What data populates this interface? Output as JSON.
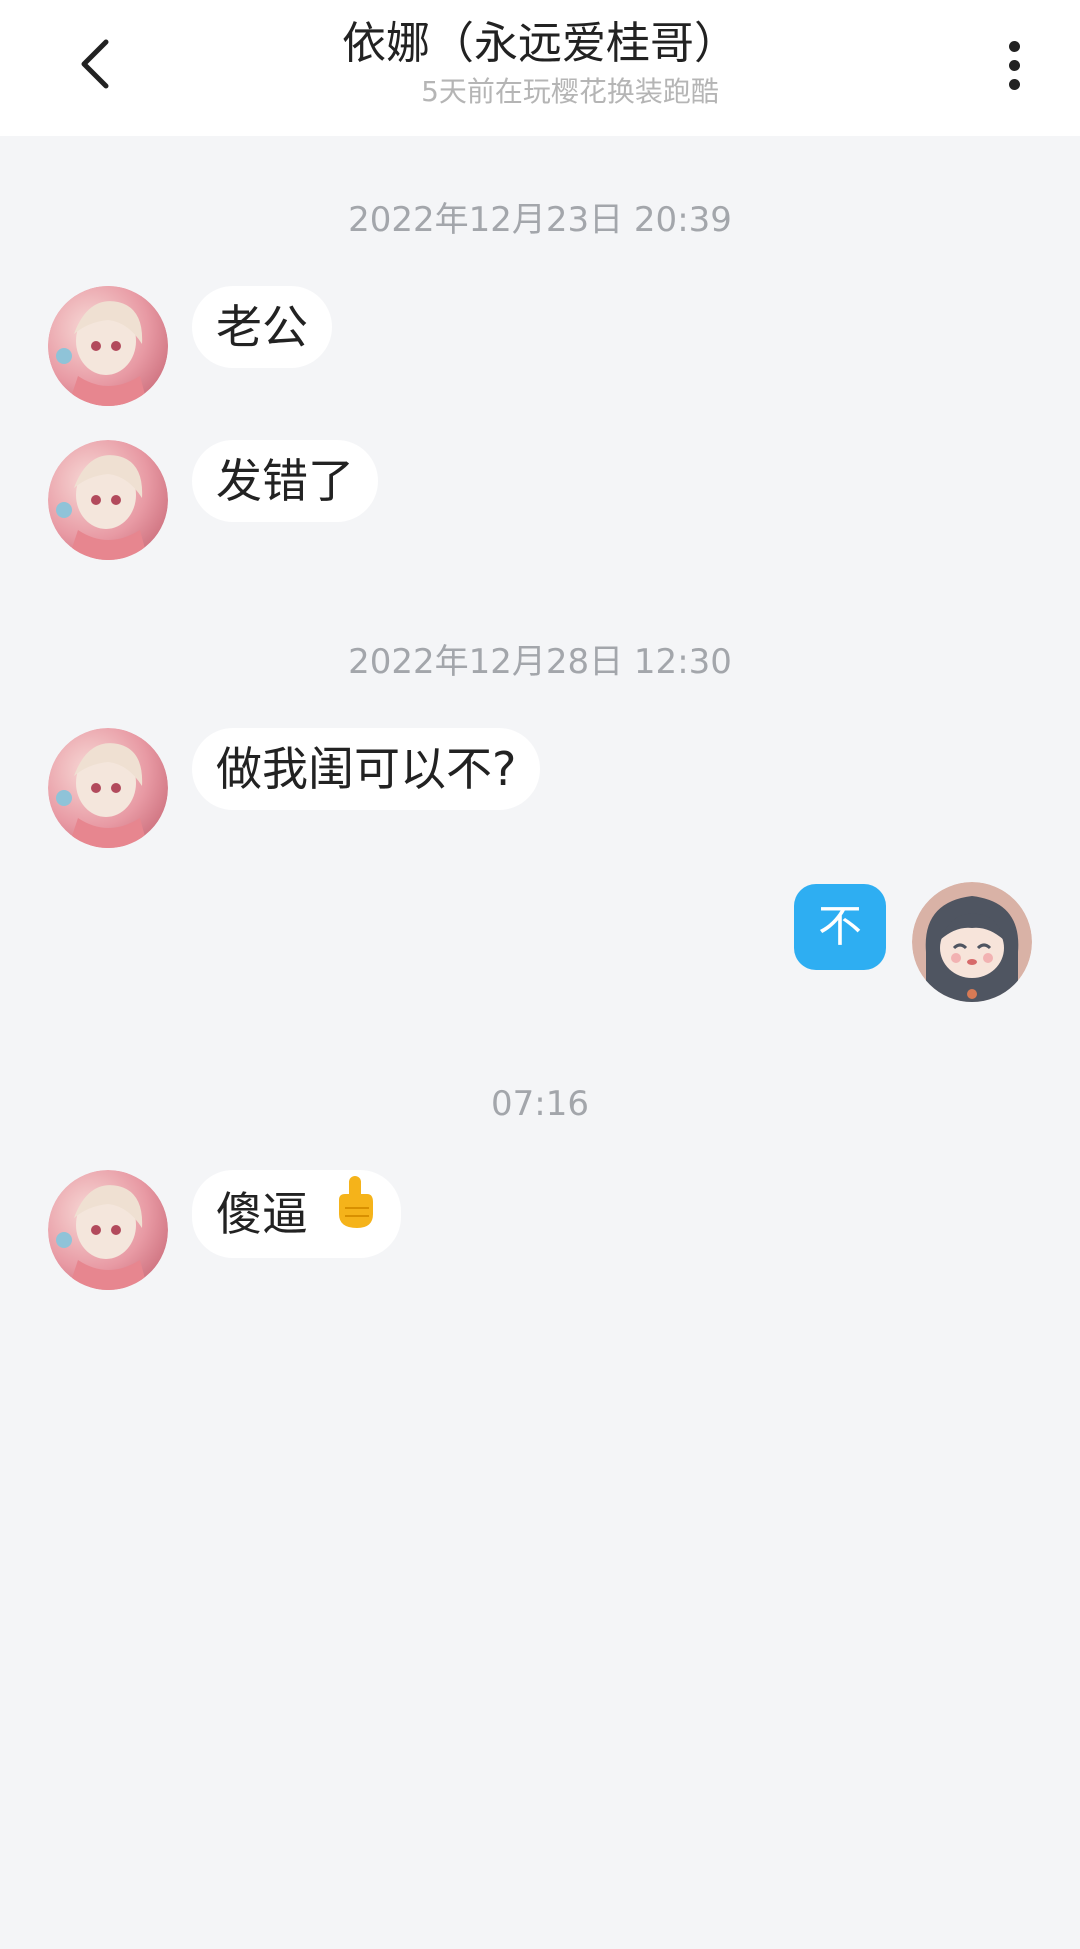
{
  "header": {
    "title": "依娜（永远爱桂哥）",
    "subtitle": "5天前在玩樱花换装跑酷",
    "back_icon": "chevron-left-icon",
    "more_icon": "more-vertical-icon"
  },
  "messages": {
    "ts1": "2022年12月23日 20:39",
    "m1": "老公",
    "m2": "发错了",
    "ts2": "2022年12月28日 12:30",
    "m3": "做我闺可以不?",
    "m4": "不",
    "ts3": "07:16",
    "m5": "傻逼"
  },
  "icons": {
    "emoji": "middle-finger-emoji-icon"
  },
  "colors": {
    "sent_bubble": "#2eaef2",
    "received_bubble": "#ffffff",
    "background": "#f4f5f7",
    "timestamp_text": "#a3a6ab"
  }
}
